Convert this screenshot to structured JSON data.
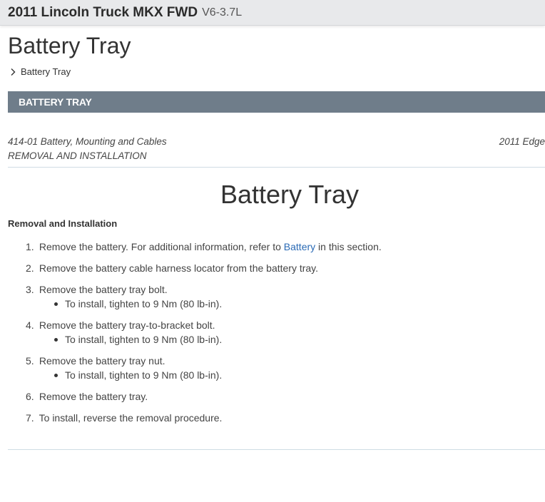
{
  "header": {
    "vehicle": "2011 Lincoln Truck MKX FWD",
    "engine": "V6-3.7L"
  },
  "page_title": "Battery Tray",
  "breadcrumb": {
    "item": "Battery Tray"
  },
  "section_bar": {
    "label": "BATTERY TRAY"
  },
  "doc_header": {
    "section": "414-01 Battery, Mounting and Cables",
    "model": "2011 Edge",
    "procedure": "REMOVAL AND INSTALLATION"
  },
  "article": {
    "title": "Battery Tray",
    "subhead": "Removal and Installation",
    "steps": [
      {
        "num": "1.",
        "text_before": "Remove the battery. For additional information, refer to ",
        "link": "Battery",
        "text_after": " in this section."
      },
      {
        "num": "2.",
        "text": "Remove the battery cable harness locator from the battery tray."
      },
      {
        "num": "3.",
        "text": "Remove the battery tray bolt.",
        "bullet": "To install, tighten to 9 Nm (80 lb-in)."
      },
      {
        "num": "4.",
        "text": "Remove the battery tray-to-bracket bolt.",
        "bullet": "To install, tighten to 9 Nm (80 lb-in)."
      },
      {
        "num": "5.",
        "text": "Remove the battery tray nut.",
        "bullet": "To install, tighten to 9 Nm (80 lb-in)."
      },
      {
        "num": "6.",
        "text": "Remove the battery tray."
      },
      {
        "num": "7.",
        "text": "To install, reverse the removal procedure."
      }
    ]
  }
}
